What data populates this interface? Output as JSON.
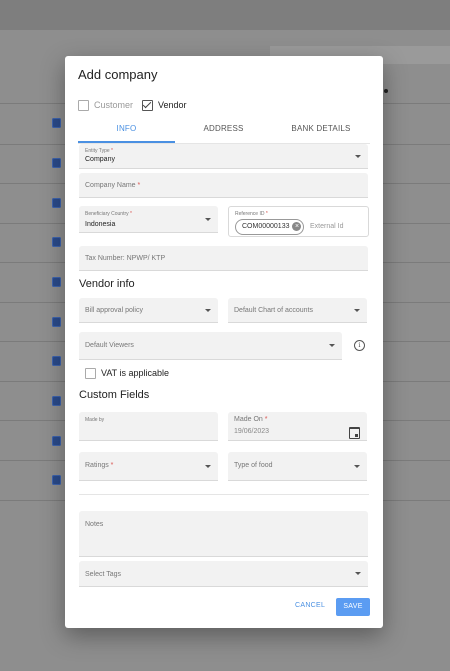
{
  "modal": {
    "title": "Add company",
    "checkboxes": [
      {
        "label": "Customer",
        "checked": false
      },
      {
        "label": "Vendor",
        "checked": true
      }
    ],
    "tabs": [
      {
        "label": "INFO",
        "active": true
      },
      {
        "label": "ADDRESS",
        "active": false
      },
      {
        "label": "BANK DETAILS",
        "active": false
      }
    ]
  },
  "info": {
    "entity_type": {
      "label": "Entity Type",
      "value": "Company"
    },
    "company_name": {
      "label": "Company Name"
    },
    "beneficiary_country": {
      "label": "Beneficiary Country",
      "value": "Indonesia"
    },
    "reference_id": {
      "label": "Reference ID",
      "chip": "COM00000133",
      "placeholder": "External Id"
    },
    "tax_number": {
      "placeholder": "Tax Number: NPWP/ KTP"
    }
  },
  "vendor_info": {
    "title": "Vendor info",
    "bill_approval_policy": "Bill approval policy",
    "default_chart_of_accounts": "Default Chart of accounts",
    "default_viewers": "Default Viewers",
    "vat_label": "VAT is applicable",
    "vat_checked": false
  },
  "custom_fields": {
    "title": "Custom Fields",
    "made_by": {
      "label": "Made by"
    },
    "made_on": {
      "label": "Made On",
      "value": "19/06/2023"
    },
    "ratings": {
      "label": "Ratings"
    },
    "type_of_food": {
      "label": "Type of food"
    }
  },
  "notes": {
    "label": "Notes"
  },
  "tags": {
    "placeholder": "Select Tags"
  },
  "actions": {
    "cancel": "CANCEL",
    "save": "SAVE"
  },
  "colors": {
    "accent": "#4a90e2",
    "required": "#d9534f",
    "save_bg": "#5b9cf2"
  },
  "icons": [
    "calendar-icon",
    "info-icon",
    "close-icon",
    "chevron-down-icon",
    "contact-card-icon"
  ]
}
